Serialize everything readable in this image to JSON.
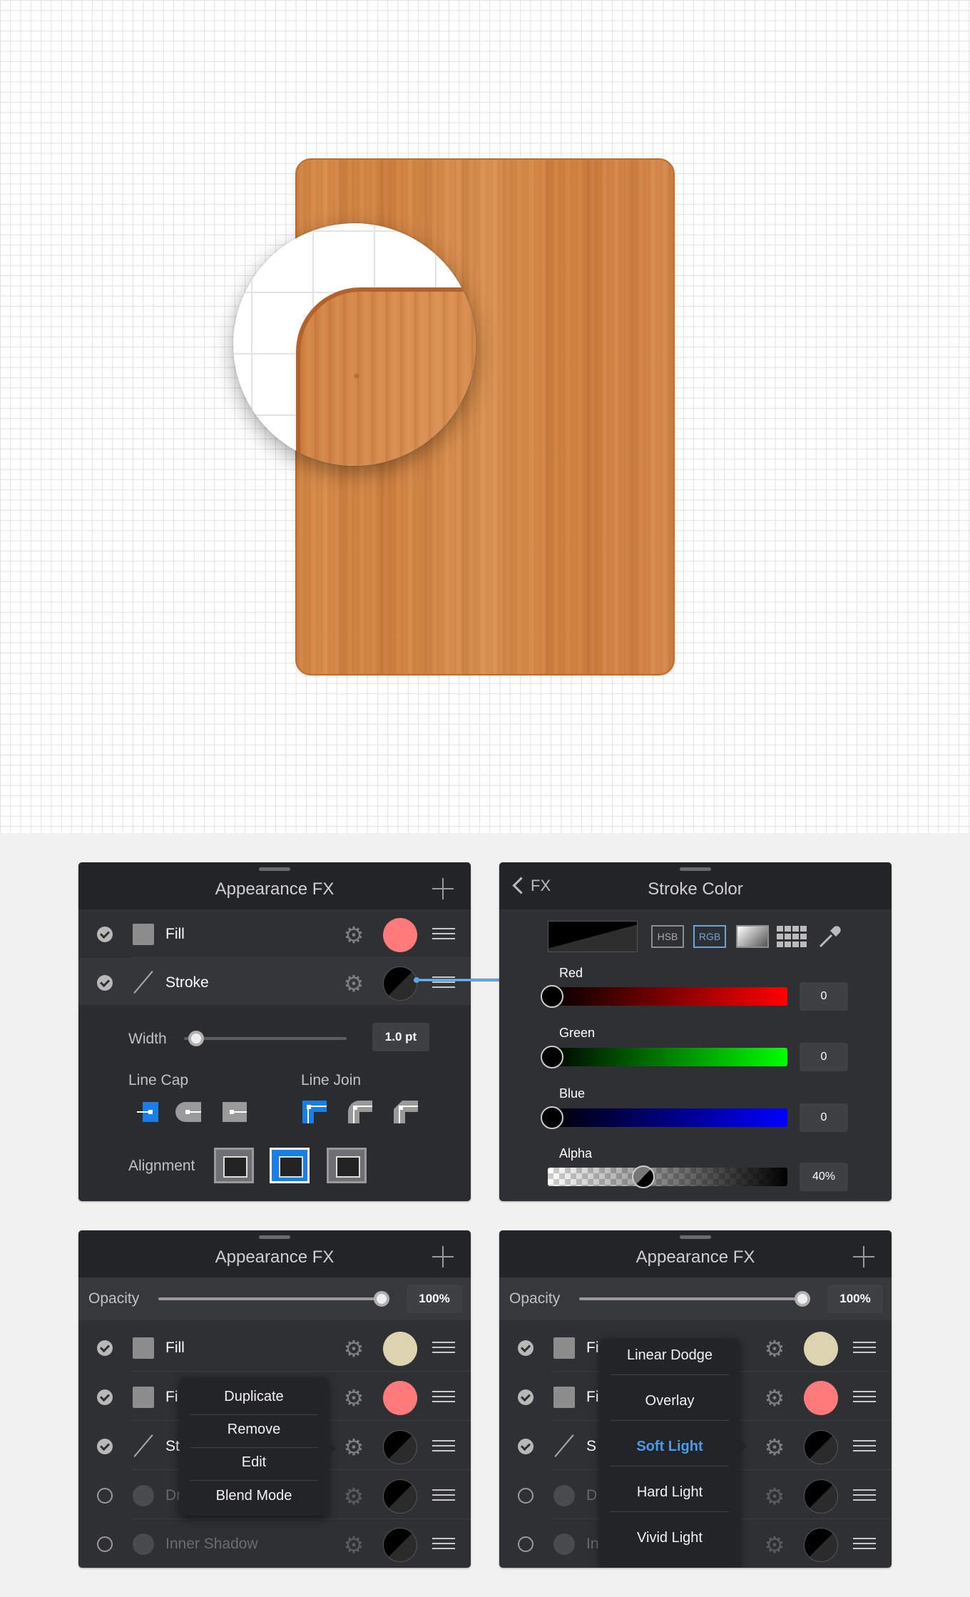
{
  "canvas": {
    "wood_color": "#d68a48",
    "grid": "light-gray"
  },
  "panel_appearance_stroke": {
    "title": "Appearance FX",
    "rows": [
      {
        "label": "Fill",
        "color": "#ff7b7b"
      },
      {
        "label": "Stroke",
        "color": "#000000"
      }
    ],
    "width_label": "Width",
    "width_value": "1.0 pt",
    "line_cap_label": "Line Cap",
    "line_join_label": "Line Join",
    "alignment_label": "Alignment",
    "active_color": "#1a7fe5"
  },
  "panel_stroke_color": {
    "back_label": "FX",
    "title": "Stroke Color",
    "modes": [
      "HSB",
      "RGB"
    ],
    "active_mode": "RGB",
    "channels": [
      {
        "label": "Red",
        "value": "0"
      },
      {
        "label": "Green",
        "value": "0"
      },
      {
        "label": "Blue",
        "value": "0"
      },
      {
        "label": "Alpha",
        "value": "40%"
      }
    ]
  },
  "panel_context_menu": {
    "title": "Appearance FX",
    "opacity_label": "Opacity",
    "opacity_value": "100%",
    "rows": [
      {
        "label": "Fill",
        "color": "#ddd3b0"
      },
      {
        "label": "Fi",
        "color": "#ff7b7b"
      },
      {
        "label": "St",
        "color": "#000000"
      },
      {
        "label": "Dr",
        "color": "#000000"
      },
      {
        "label": "Inner Shadow",
        "color": "#000000"
      }
    ],
    "menu": [
      "Duplicate",
      "Remove",
      "Edit",
      "Blend Mode"
    ]
  },
  "panel_blend_mode": {
    "title": "Appearance FX",
    "opacity_label": "Opacity",
    "opacity_value": "100%",
    "rows": [
      {
        "label": "Fi",
        "color": "#ddd3b0"
      },
      {
        "label": "Fi",
        "color": "#ff7b7b"
      },
      {
        "label": "S",
        "color": "#000000"
      },
      {
        "label": "D",
        "color": "#000000"
      },
      {
        "label": "In",
        "color": "#000000"
      }
    ],
    "menu": [
      "Linear Dodge",
      "Overlay",
      "Soft Light",
      "Hard Light",
      "Vivid Light"
    ],
    "selected": "Soft Light",
    "selected_color": "#4a9be8"
  }
}
